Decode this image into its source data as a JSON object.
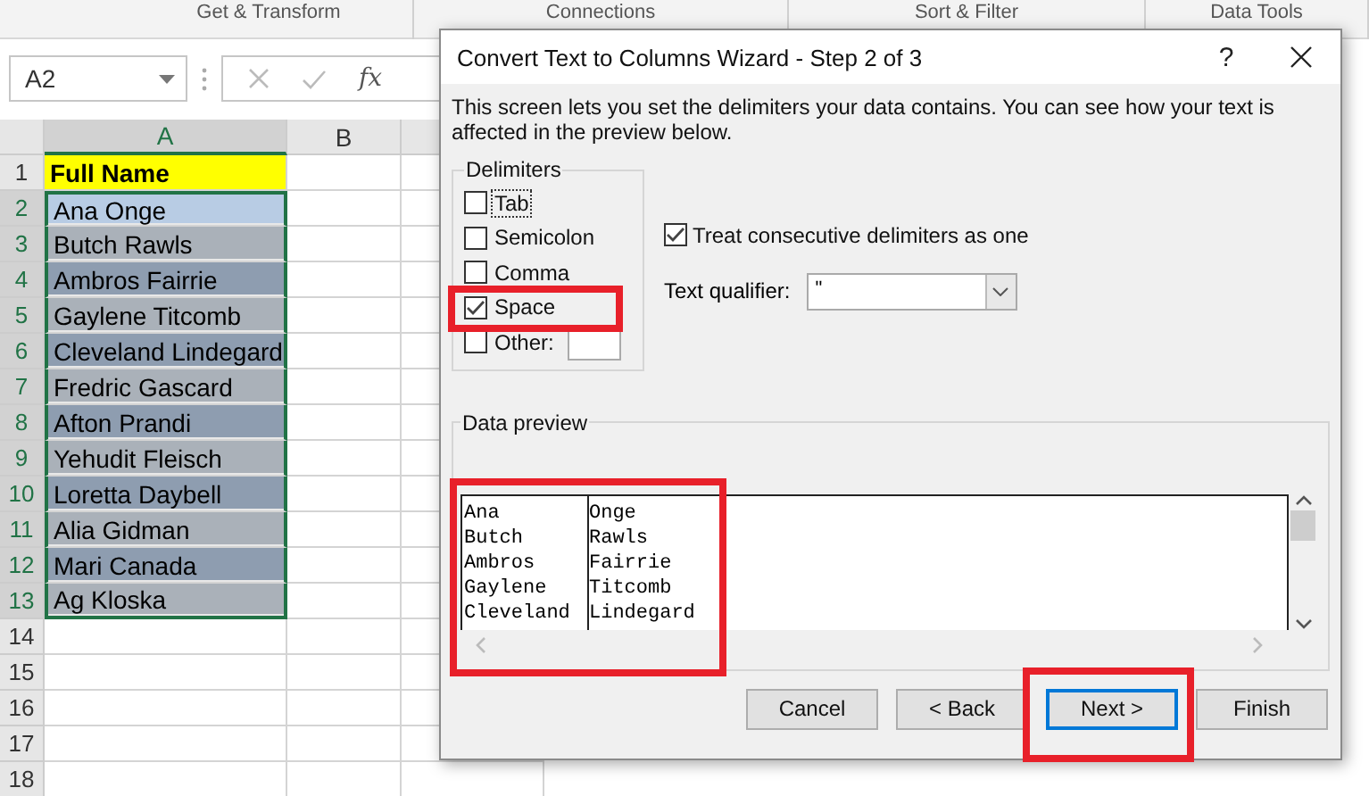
{
  "ribbon_groups": [
    "Get & Transform",
    "Connections",
    "Sort & Filter",
    "Data Tools"
  ],
  "name_box": "A2",
  "function_label": "fx",
  "columns": [
    {
      "label": "A",
      "selected": true
    },
    {
      "label": "B",
      "selected": false
    },
    {
      "selected": false
    }
  ],
  "rows": [
    {
      "number": "1",
      "value": "Full Name",
      "kind": "header",
      "selected": false,
      "color": "#ffff00"
    },
    {
      "number": "2",
      "value": "Ana Onge",
      "kind": "data",
      "selected": true,
      "color": "#b8cce4"
    },
    {
      "number": "3",
      "value": "Butch Rawls",
      "kind": "data",
      "selected": true,
      "color": "#aab1b9"
    },
    {
      "number": "4",
      "value": "Ambros Fairrie",
      "kind": "data",
      "selected": true,
      "color": "#8e9db0"
    },
    {
      "number": "5",
      "value": "Gaylene Titcomb",
      "kind": "data",
      "selected": true,
      "color": "#aab1b9"
    },
    {
      "number": "6",
      "value": "Cleveland Lindegard",
      "kind": "data",
      "selected": true,
      "color": "#8e9db0"
    },
    {
      "number": "7",
      "value": "Fredric Gascard",
      "kind": "data",
      "selected": true,
      "color": "#aab1b9"
    },
    {
      "number": "8",
      "value": "Afton Prandi",
      "kind": "data",
      "selected": true,
      "color": "#8e9db0"
    },
    {
      "number": "9",
      "value": "Yehudit Fleisch",
      "kind": "data",
      "selected": true,
      "color": "#aab1b9"
    },
    {
      "number": "10",
      "value": "Loretta Daybell",
      "kind": "data",
      "selected": true,
      "color": "#8e9db0"
    },
    {
      "number": "11",
      "value": "Alia Gidman",
      "kind": "data",
      "selected": true,
      "color": "#aab1b9"
    },
    {
      "number": "12",
      "value": "Mari Canada",
      "kind": "data",
      "selected": true,
      "color": "#8e9db0"
    },
    {
      "number": "13",
      "value": "Ag Kloska",
      "kind": "data",
      "selected": true,
      "color": "#aab1b9"
    },
    {
      "number": "14",
      "selected": false
    },
    {
      "number": "15",
      "selected": false
    },
    {
      "number": "16",
      "selected": false
    },
    {
      "number": "17",
      "selected": false
    },
    {
      "number": "18",
      "selected": false
    }
  ],
  "dialog": {
    "title": "Convert Text to Columns Wizard - Step 2 of 3",
    "help": "?",
    "description": "This screen lets you set the delimiters your data contains.  You can see how your text is affected in the preview below.",
    "delimiters": {
      "legend": "Delimiters",
      "items": [
        {
          "label": "Tab",
          "checked": false,
          "focused": true
        },
        {
          "label": "Semicolon",
          "checked": false,
          "focused": false
        },
        {
          "label": "Comma",
          "checked": false,
          "focused": false
        },
        {
          "label": "Space",
          "checked": true,
          "focused": false
        },
        {
          "label": "Other:",
          "checked": false,
          "focused": false
        }
      ]
    },
    "consecutive": {
      "label": "Treat consecutive delimiters as one",
      "checked": true
    },
    "text_qualifier": {
      "label": "Text qualifier:",
      "value": "\""
    },
    "preview": {
      "legend": "Data preview",
      "rows": [
        [
          "Ana",
          "Onge"
        ],
        [
          "Butch",
          "Rawls"
        ],
        [
          "Ambros",
          "Fairrie"
        ],
        [
          "Gaylene",
          "Titcomb"
        ],
        [
          "Cleveland",
          "Lindegard"
        ]
      ]
    },
    "buttons": [
      {
        "label": "Cancel",
        "focused": false
      },
      {
        "label": "< Back",
        "focused": false
      },
      {
        "label": "Next >",
        "focused": true
      },
      {
        "label": "Finish",
        "focused": false
      }
    ]
  }
}
